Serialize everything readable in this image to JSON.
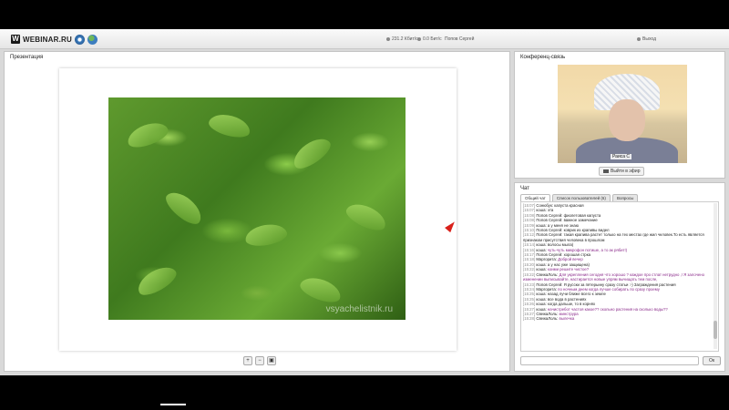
{
  "app": {
    "logo_letter": "W",
    "logo_text": "WEBINAR.RU"
  },
  "topbar": {
    "speed": "231.2 Кбит/с",
    "bitrate": "0.0 Бит/с",
    "user": "Попов Сергей",
    "exit_label": "Выход"
  },
  "presentation": {
    "title": "Презентация",
    "watermark": "vsyachelistnik.ru",
    "zoom_in_icon": "zoom-in-icon",
    "zoom_out_icon": "zoom-out-icon",
    "save_icon": "save-icon"
  },
  "conference": {
    "title": "Конференц-связь",
    "participant_label": "Раиса С",
    "leave_label": "Выйти в эфир"
  },
  "chat": {
    "title": "Чат",
    "tabs": [
      "Общий чат",
      "Список пользователей (6)",
      "Вопросы"
    ],
    "send_label": "Ок",
    "messages": [
      {
        "time": "[15:07]",
        "user": "Сонюбук:",
        "text": "капуста красная",
        "style": ""
      },
      {
        "time": "[15:07]",
        "user": "коша:",
        "text": "эта",
        "style": ""
      },
      {
        "time": "[15:08]",
        "user": "Попов Сергей:",
        "text": "фиолетовая капуста",
        "style": ""
      },
      {
        "time": "[15:08]",
        "user": "Попов Сергей:",
        "text": "важное замечание",
        "style": ""
      },
      {
        "time": "[15:09]",
        "user": "коша:",
        "text": "а у меня не знаю",
        "style": ""
      },
      {
        "time": "[15:10]",
        "user": "Попов Сергей:",
        "text": "коврик из крапивы видел",
        "style": ""
      },
      {
        "time": "[15:12]",
        "user": "Попов Сергей:",
        "text": "такая крапива растет только на тех местах где жил человек.То есть является признаком присутствия человека в прошлом",
        "style": "wrap"
      },
      {
        "time": "[15:14]",
        "user": "коша:",
        "text": "волосы мыла)",
        "style": ""
      },
      {
        "time": "[15:16]",
        "user": "коша:",
        "text": "чуть-чуть микрофон потише, а то ак рябит!)",
        "style": "purple"
      },
      {
        "time": "[15:17]",
        "user": "Попов Сергей:",
        "text": "хорошая стрка",
        "style": ""
      },
      {
        "time": "[15:18]",
        "user": "Маргорита:",
        "text": "Доброй вечер",
        "style": "purple"
      },
      {
        "time": "[15:20]",
        "user": "коша:",
        "text": "а у нас уже защищена)",
        "style": ""
      },
      {
        "time": "[15:22]",
        "user": "коша:",
        "text": "коими решите чистое?",
        "style": "purple"
      },
      {
        "time": "[15:22]",
        "user": "СвежаЛоль:",
        "text": "Для укрепления сегодня что хорошо ? каждое про стлат нетрудно ,! Я залочено изменении выписывайте, настирается новые упрям вычищать тем после,",
        "style": "purple wrap"
      },
      {
        "time": "[15:23]",
        "user": "Попов Сергей:",
        "text": "Я русски за пятерьину сразу статьи :-) Заграждения растения",
        "style": ""
      },
      {
        "time": "[15:24]",
        "user": "Маргорита:",
        "text": "по ночным днем когда лучше собирать по сразу проему",
        "style": "purple"
      },
      {
        "time": "[15:25]",
        "user": "коша:",
        "text": "назад лучи ближе всего к земле",
        "style": ""
      },
      {
        "time": "[15:25]",
        "user": "коша:",
        "text": "все вода в растениях",
        "style": ""
      },
      {
        "time": "[15:26]",
        "user": "коша:",
        "text": "когда дальше, то в корнях",
        "style": ""
      },
      {
        "time": "[15:27]",
        "user": "коша:",
        "text": "начистребот частоя какое?? скольно растения на сколько воды??",
        "style": "purple"
      },
      {
        "time": "[15:27]",
        "user": "СвежаЛоль:",
        "text": "минструра",
        "style": "purple"
      },
      {
        "time": "[15:28]",
        "user": "СвежаЛоль:",
        "text": "вылечка",
        "style": "purple"
      }
    ]
  },
  "colors": {
    "pointer": "#d9201a",
    "accent": "#3d7ebf",
    "chat_highlight": "#8a2a8a"
  }
}
